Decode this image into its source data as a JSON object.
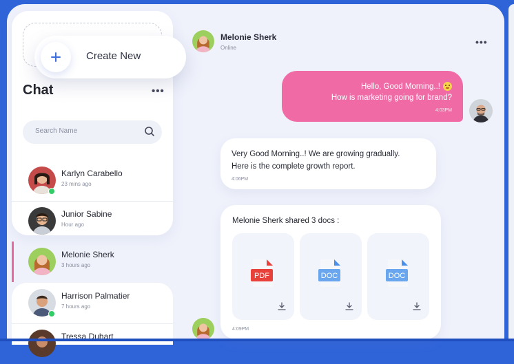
{
  "sidebar": {
    "create_new_label": "Create New",
    "title": "Chat",
    "more_label": "•••",
    "search_placeholder": "Search Name",
    "contacts": [
      {
        "name": "Karlyn Carabello",
        "time": "23 mins ago",
        "online": true
      },
      {
        "name": "Junior Sabine",
        "time": "Hour ago",
        "online": false
      },
      {
        "name": "Melonie Sherk",
        "time": "3 hours ago",
        "online": false,
        "active": true
      },
      {
        "name": "Harrison Palmatier",
        "time": "7 hours ago",
        "online": true
      },
      {
        "name": "Tressa Duhart",
        "time": "",
        "online": false
      }
    ]
  },
  "conversation": {
    "contact_name": "Melonie Sherk",
    "status": "Online",
    "more_label": "•••",
    "messages": [
      {
        "direction": "outgoing",
        "line1": "Hello, Good Morning..!",
        "line2": "How is marketing going for brand?",
        "time": "4:03PM"
      },
      {
        "direction": "incoming",
        "line1": "Very Good Morning..! We are growing gradually.",
        "line2": "Here is the complete growth report.",
        "time": "4:06PM"
      }
    ],
    "shared": {
      "title": "Melonie Sherk shared 3 docs :",
      "files": [
        {
          "type": "PDF",
          "color": "#e8403a",
          "icon": "pdf-file-icon"
        },
        {
          "type": "DOC",
          "color": "#4a8fe8",
          "icon": "doc-file-icon"
        },
        {
          "type": "DOC",
          "color": "#4a8fe8",
          "icon": "doc-file-icon"
        }
      ],
      "time": "4:09PM"
    }
  },
  "colors": {
    "background": "#2f64d9",
    "accent_pink": "#f06ba6",
    "online_green": "#33cc66",
    "plus_blue": "#3d6ee0"
  }
}
